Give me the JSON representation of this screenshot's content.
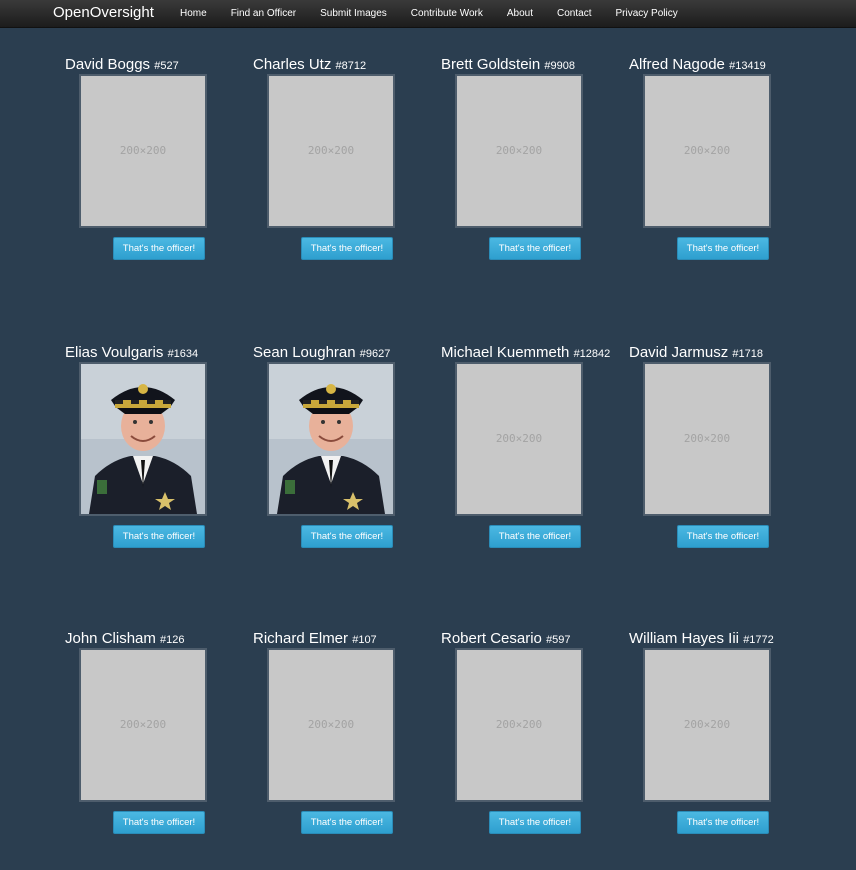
{
  "navbar": {
    "brand": "OpenOversight",
    "links": [
      "Home",
      "Find an Officer",
      "Submit Images",
      "Contribute Work",
      "About",
      "Contact",
      "Privacy Policy"
    ]
  },
  "placeholder_text": "200×200",
  "button_label": "That's the officer!",
  "officers": [
    {
      "name": "David Boggs",
      "star": "#527",
      "photo": "placeholder"
    },
    {
      "name": "Charles Utz",
      "star": "#8712",
      "photo": "placeholder"
    },
    {
      "name": "Brett Goldstein",
      "star": "#9908",
      "photo": "placeholder"
    },
    {
      "name": "Alfred Nagode",
      "star": "#13419",
      "photo": "placeholder"
    },
    {
      "name": "Elias Voulgaris",
      "star": "#1634",
      "photo": "officer-portrait"
    },
    {
      "name": "Sean Loughran",
      "star": "#9627",
      "photo": "officer-portrait"
    },
    {
      "name": "Michael Kuemmeth",
      "star": "#12842",
      "photo": "placeholder"
    },
    {
      "name": "David Jarmusz",
      "star": "#1718",
      "photo": "placeholder"
    },
    {
      "name": "John Clisham",
      "star": "#126",
      "photo": "placeholder"
    },
    {
      "name": "Richard Elmer",
      "star": "#107",
      "photo": "placeholder"
    },
    {
      "name": "Robert Cesario",
      "star": "#597",
      "photo": "placeholder"
    },
    {
      "name": "William Hayes Iii",
      "star": "#1772",
      "photo": "placeholder"
    }
  ],
  "colors": {
    "background": "#2b3e50",
    "button": "#2fa4d7",
    "placeholder": "#c8c8c8"
  }
}
